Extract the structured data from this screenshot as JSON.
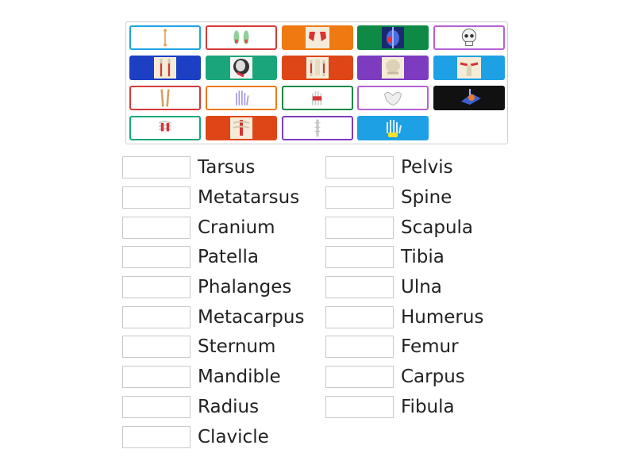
{
  "colors": {
    "blue_light": "#1ea3e0",
    "red": "#d63a3a",
    "orange": "#ef7a11",
    "green_dark": "#0e8a45",
    "violet": "#b560d4",
    "navy": "#1c3fc4",
    "teal": "#1aa67a",
    "red_orange": "#df4617",
    "purple": "#7d3cc0",
    "sky": "#1da1e4",
    "black": "#111111"
  },
  "tiles": [
    {
      "name": "femur-tile",
      "style": "outline",
      "color": "#1ea3e0",
      "icon": "long-bone-icon"
    },
    {
      "name": "feet-tile",
      "style": "outline",
      "color": "#d63a3a",
      "icon": "feet-icon"
    },
    {
      "name": "scapula-tile",
      "style": "filled",
      "color": "#ef7a11",
      "icon": "torso-red-icon"
    },
    {
      "name": "patella-tile",
      "style": "filled",
      "color": "#0e8a45",
      "icon": "knee-xray-icon"
    },
    {
      "name": "cranium-tile",
      "style": "outline",
      "color": "#b560d4",
      "icon": "skull-icon"
    },
    {
      "name": "legs-tile",
      "style": "filled",
      "color": "#1c3fc4",
      "icon": "skeleton-legs-icon"
    },
    {
      "name": "skull-xray-tile",
      "style": "filled",
      "color": "#1aa67a",
      "icon": "skull-xray-icon"
    },
    {
      "name": "arms-tile",
      "style": "filled",
      "color": "#df4617",
      "icon": "skeleton-arms-icon"
    },
    {
      "name": "hip-tile",
      "style": "filled",
      "color": "#7d3cc0",
      "icon": "torso-icon"
    },
    {
      "name": "clavicle-tile",
      "style": "filled",
      "color": "#1da1e4",
      "icon": "shoulders-icon"
    },
    {
      "name": "tibia-fibula-tile",
      "style": "outline",
      "color": "#d63a3a",
      "icon": "leg-bones-icon"
    },
    {
      "name": "hand-tile",
      "style": "outline",
      "color": "#ef7a11",
      "icon": "hand-bones-icon"
    },
    {
      "name": "hand-red-tile",
      "style": "outline",
      "color": "#0e8a45",
      "icon": "hand-red-icon"
    },
    {
      "name": "pelvis-tile",
      "style": "outline",
      "color": "#b560d4",
      "icon": "pelvis-icon"
    },
    {
      "name": "foot-xray-tile",
      "style": "filled",
      "color": "#111111",
      "icon": "foot-xray-icon"
    },
    {
      "name": "ribcage-tile",
      "style": "outline",
      "color": "#1aa67a",
      "icon": "ribcage-icon"
    },
    {
      "name": "sternum-tile",
      "style": "filled",
      "color": "#df4617",
      "icon": "chest-icon"
    },
    {
      "name": "spine-tile",
      "style": "outline",
      "color": "#7d3cc0",
      "icon": "spine-icon"
    },
    {
      "name": "wrist-tile",
      "style": "filled",
      "color": "#1da1e4",
      "icon": "wrist-icon"
    }
  ],
  "left_labels": [
    "Tarsus",
    "Metatarsus",
    "Cranium",
    "Patella",
    "Phalanges",
    "Metacarpus",
    "Sternum",
    "Mandible",
    "Radius",
    "Clavicle"
  ],
  "right_labels": [
    "Pelvis",
    "Spine",
    "Scapula",
    "Tibia",
    "Ulna",
    "Humerus",
    "Femur",
    "Carpus",
    "Fibula"
  ]
}
